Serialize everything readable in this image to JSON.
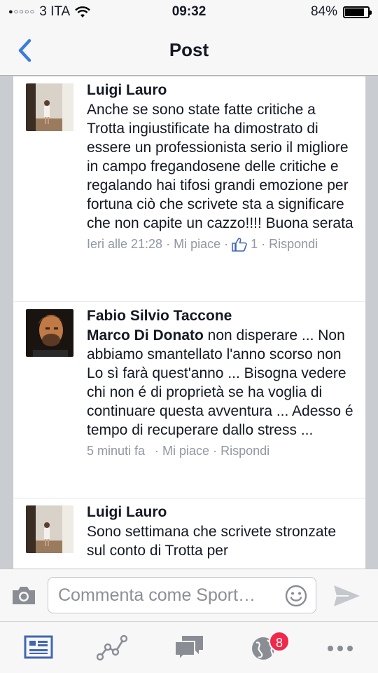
{
  "status_bar": {
    "carrier": "3 ITA",
    "signal_dots": "●○○○○",
    "time": "09:32",
    "battery_percent_label": "84%",
    "battery_level": 0.84
  },
  "nav": {
    "title": "Post",
    "back_icon": "chevron-left-icon"
  },
  "comments": [
    {
      "author": "Luigi Lauro",
      "text": "Anche se sono state fatte critiche a Trotta ingiustificate ha dimostrato di essere un professionista serio il migliore in campo fregandosene delle critiche e regalando hai tifosi grandi emozione per fortuna ciò che scrivete sta a significare che non capite un cazzo!!!! Buona serata",
      "time": "Ieri alle 21:28",
      "like_label": "Mi piace",
      "like_count": "1",
      "reply_label": "Rispondi",
      "separator": "·"
    },
    {
      "author": "Fabio Silvio Taccone",
      "mention": "Marco Di Donato",
      "text": " non disperare ... Non abbiamo smantellato l'anno scorso non Lo sì farà quest'anno ... Bisogna vedere chi non é di proprietà se ha voglia di continuare questa avventura ... Adesso é tempo di recuperare dallo stress ...",
      "time": "5 minuti fa",
      "like_label": "Mi piace",
      "reply_label": "Rispondi",
      "separator": "·"
    },
    {
      "author": "Luigi Lauro",
      "text": "Sono settimana che scrivete stronzate sul conto di Trotta per"
    }
  ],
  "comment_input": {
    "placeholder": "Commenta come Sport…"
  },
  "tab_bar": {
    "tabs": [
      "news-feed-icon",
      "activity-graph-icon",
      "messages-icon",
      "notifications-globe-icon",
      "more-icon"
    ],
    "notification_badge": "8"
  },
  "colors": {
    "ios_blue": "#3b7ddd",
    "facebook_blue": "#4267b2",
    "meta_gray": "#9197a3",
    "badge_red": "#f02849"
  }
}
